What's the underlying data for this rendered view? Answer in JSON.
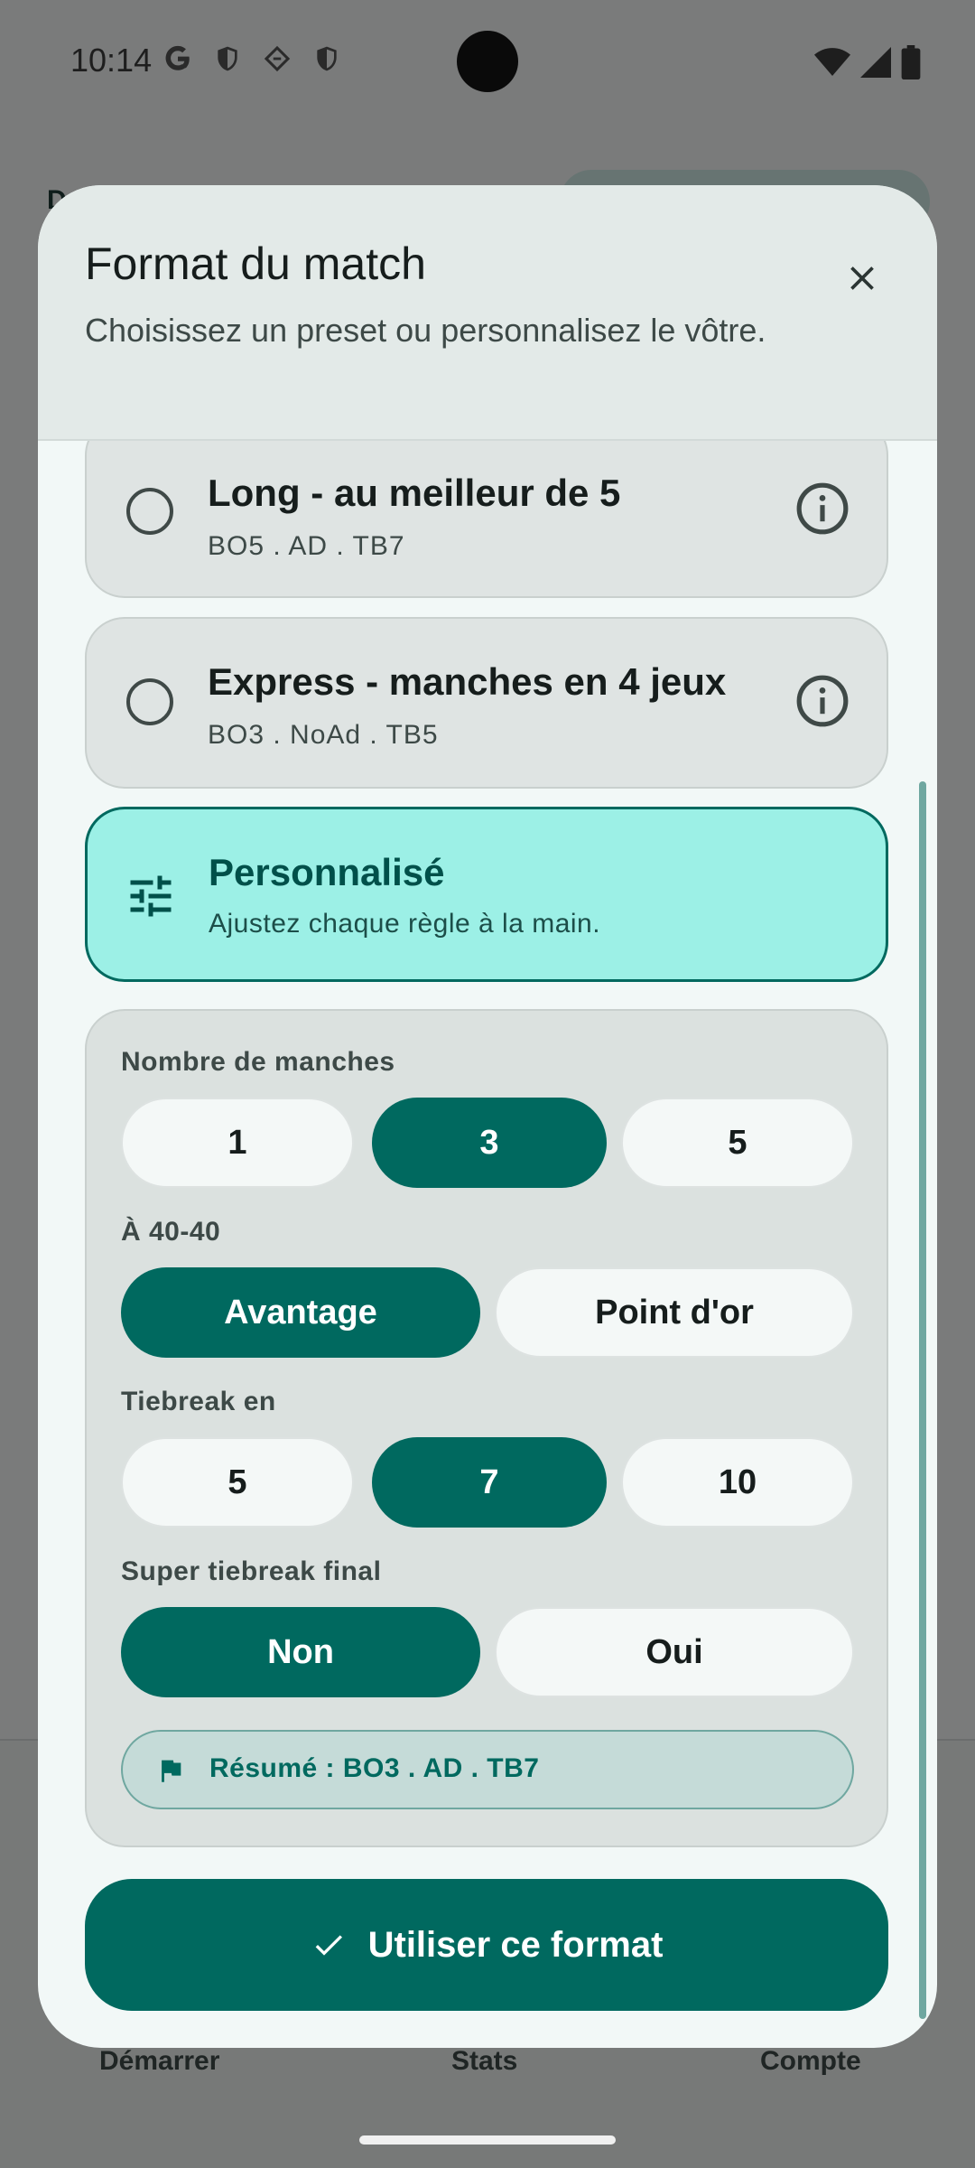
{
  "status_bar": {
    "time": "10:14",
    "left_icons": [
      "google-icon",
      "shield-icon",
      "vpn-diamond-icon",
      "shield-icon"
    ],
    "right_icons": [
      "wifi-icon",
      "signal-icon",
      "battery-icon"
    ]
  },
  "background": {
    "title_fragment": "D",
    "nav_items": [
      {
        "label": "Démarrer"
      },
      {
        "label": "Stats"
      },
      {
        "label": "Compte"
      }
    ]
  },
  "dialog": {
    "title": "Format du match",
    "subtitle": "Choisissez un preset ou personnalisez le vôtre.",
    "close_icon": "close-icon",
    "presets": [
      {
        "title": "Long - au meilleur de 5",
        "subtitle": "BO5 . AD . TB7",
        "selected": false
      },
      {
        "title": "Express - manches en 4 jeux",
        "subtitle": "BO3 . NoAd . TB5",
        "selected": false
      }
    ],
    "custom": {
      "title": "Personnalisé",
      "subtitle": "Ajustez chaque règle à la main.",
      "icon": "tune-icon",
      "selected": true
    },
    "settings": {
      "sets": {
        "label": "Nombre de manches",
        "options": [
          "1",
          "3",
          "5"
        ],
        "selected": "3"
      },
      "deuce": {
        "label": "À 40-40",
        "options": [
          "Avantage",
          "Point d'or"
        ],
        "selected": "Avantage"
      },
      "tiebreak": {
        "label": "Tiebreak en",
        "options": [
          "5",
          "7",
          "10"
        ],
        "selected": "7"
      },
      "super_tiebreak": {
        "label": "Super tiebreak final",
        "options": [
          "Non",
          "Oui"
        ],
        "selected": "Non"
      },
      "summary": "Résumé : BO3 . AD . TB7",
      "summary_icon": "flag-icon"
    },
    "confirm_button": {
      "label": "Utiliser ce format",
      "icon": "check-icon"
    }
  },
  "colors": {
    "accent": "#00695f",
    "accent_light": "#9cf0e6",
    "scrim": "#757575"
  }
}
